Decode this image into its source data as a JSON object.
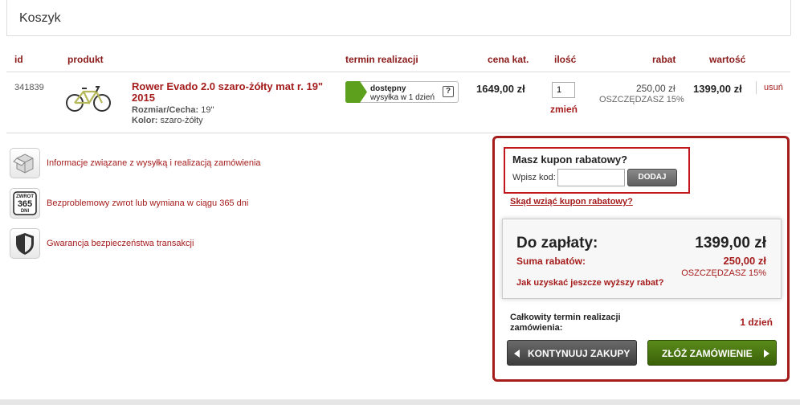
{
  "page": {
    "title": "Koszyk"
  },
  "table": {
    "headers": {
      "id": "id",
      "product": "produkt",
      "term": "termin realizacji",
      "price": "cena kat.",
      "qty": "ilość",
      "discount": "rabat",
      "value": "wartość"
    },
    "rows": [
      {
        "id": "341839",
        "name": "Rower Evado 2.0 szaro-żółty mat r. 19\" 2015",
        "size_label": "Rozmiar/Cecha:",
        "size_value": "19\"",
        "color_label": "Kolor:",
        "color_value": "szaro-żółty",
        "availability": "dostępny",
        "shipping": "wysyłka w 1 dzień",
        "help": "?",
        "price": "1649,00 zł",
        "qty": "1",
        "change": "zmień",
        "discount": "250,00 zł",
        "discount_save": "OSZCZĘDZASZ 15%",
        "value": "1399,00 zł",
        "remove": "usuń"
      }
    ]
  },
  "info": [
    {
      "icon": "box-icon",
      "text": "Informacje związane z wysyłką i realizacją zamówienia"
    },
    {
      "icon": "return-365-icon",
      "text": "Bezproblemowy zwrot lub wymiana w ciągu 365 dni"
    },
    {
      "icon": "shield-icon",
      "text": "Gwarancja bezpieczeństwa transakcji"
    }
  ],
  "return_icon_text": {
    "top": "ZWROT",
    "num": "365",
    "bottom": "DNI"
  },
  "summary": {
    "coupon_title": "Masz kupon rabatowy?",
    "coupon_label": "Wpisz kod:",
    "coupon_value": "",
    "coupon_button": "DODAJ",
    "coupon_link": "Skąd wziąć kupon rabatowy?",
    "total_label": "Do zapłaty:",
    "total_value": "1399,00 zł",
    "discount_label": "Suma rabatów:",
    "discount_value": "250,00 zł",
    "discount_save": "OSZCZĘDZASZ 15%",
    "higher_link": "Jak uzyskać jeszcze wyższy rabat?",
    "term_label": "Całkowity termin realizacji zamówienia:",
    "term_value": "1 dzień",
    "continue_button": "KONTYNUUJ ZAKUPY",
    "order_button": "ZŁÓŻ ZAMÓWIENIE"
  },
  "colors": {
    "accent": "#a51c1c",
    "order_green": "#4a7512",
    "highlight_red": "#c4171d"
  }
}
